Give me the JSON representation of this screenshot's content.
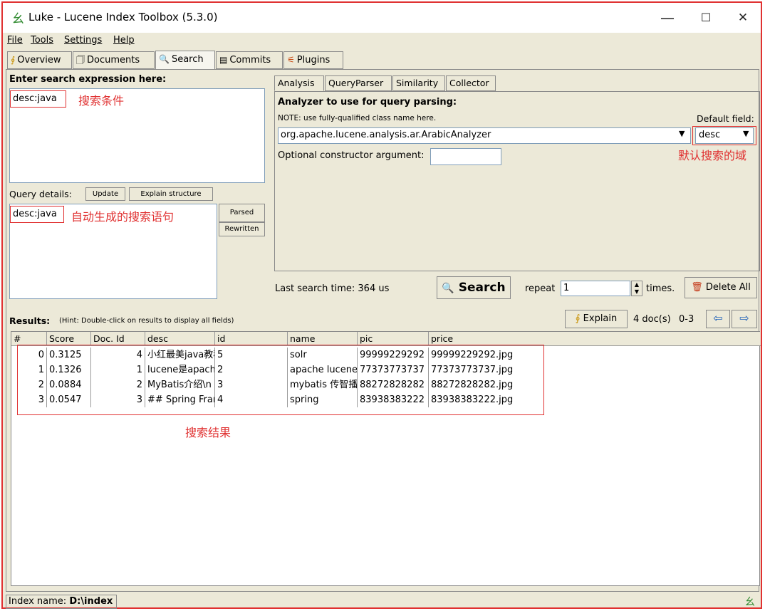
{
  "window": {
    "title": "Luke - Lucene Index Toolbox (5.3.0)",
    "minimize": "—",
    "maximize": "☐",
    "close": "✕"
  },
  "menu": {
    "file": "File",
    "tools": "Tools",
    "settings": "Settings",
    "help": "Help"
  },
  "tabs": [
    "Overview",
    "Documents",
    "Search",
    "Commits",
    "Plugins"
  ],
  "search": {
    "heading": "Enter search expression here:",
    "expression": "desc:java",
    "annotation_expression": "搜索条件",
    "query_details_label": "Query details:",
    "update_btn": "Update",
    "explain_structure_btn": "Explain structure",
    "parsed_query": "desc:java",
    "annotation_parsed": "自动生成的搜索语句",
    "parsed_btn": "Parsed",
    "rewritten_btn": "Rewritten"
  },
  "analysis_tabs": [
    "Analysis",
    "QueryParser",
    "Similarity",
    "Collector"
  ],
  "analysis": {
    "heading": "Analyzer to use for query parsing:",
    "note": "NOTE: use fully-qualified class name here.",
    "analyzer_value": "org.apache.lucene.analysis.ar.ArabicAnalyzer",
    "default_field_label": "Default field:",
    "default_field_value": "desc",
    "annotation_default_field": "默认搜索的域",
    "constructor_label": "Optional constructor argument:",
    "constructor_value": ""
  },
  "actions": {
    "last_search_time": "Last search time: 364 us",
    "search_btn": "Search",
    "repeat_label": "repeat",
    "repeat_value": "1",
    "times_label": "times.",
    "delete_all_btn": "Delete All"
  },
  "results": {
    "label": "Results:",
    "hint": "(Hint: Double-click on results to display all fields)",
    "explain_btn": "Explain",
    "doc_count": "4 doc(s)",
    "range": "0-3",
    "prev_arrow": "⇦",
    "next_arrow": "⇨",
    "columns": [
      "#",
      "Score",
      "Doc. Id",
      "desc",
      "id",
      "name",
      "pic",
      "price"
    ],
    "rows": [
      [
        "0",
        "0.3125",
        "4",
        "小红最美java教程",
        "5",
        "solr",
        "99999229292",
        "99999229292.jpg"
      ],
      [
        "1",
        "0.1326",
        "1",
        "lucene是apache",
        "2",
        "apache lucene",
        "77373773737",
        "77373773737.jpg"
      ],
      [
        "2",
        "0.0884",
        "2",
        "MyBatis介绍\\n",
        "3",
        "mybatis 传智播客",
        "88272828282",
        "88272828282.jpg"
      ],
      [
        "3",
        "0.0547",
        "3",
        "## Spring Framework",
        "4",
        "spring",
        "83938383222",
        "83938383222.jpg"
      ]
    ],
    "annotation_results": "搜索结果"
  },
  "status": {
    "index_name_label": "Index name:",
    "index_name_value": "D:\\index"
  }
}
